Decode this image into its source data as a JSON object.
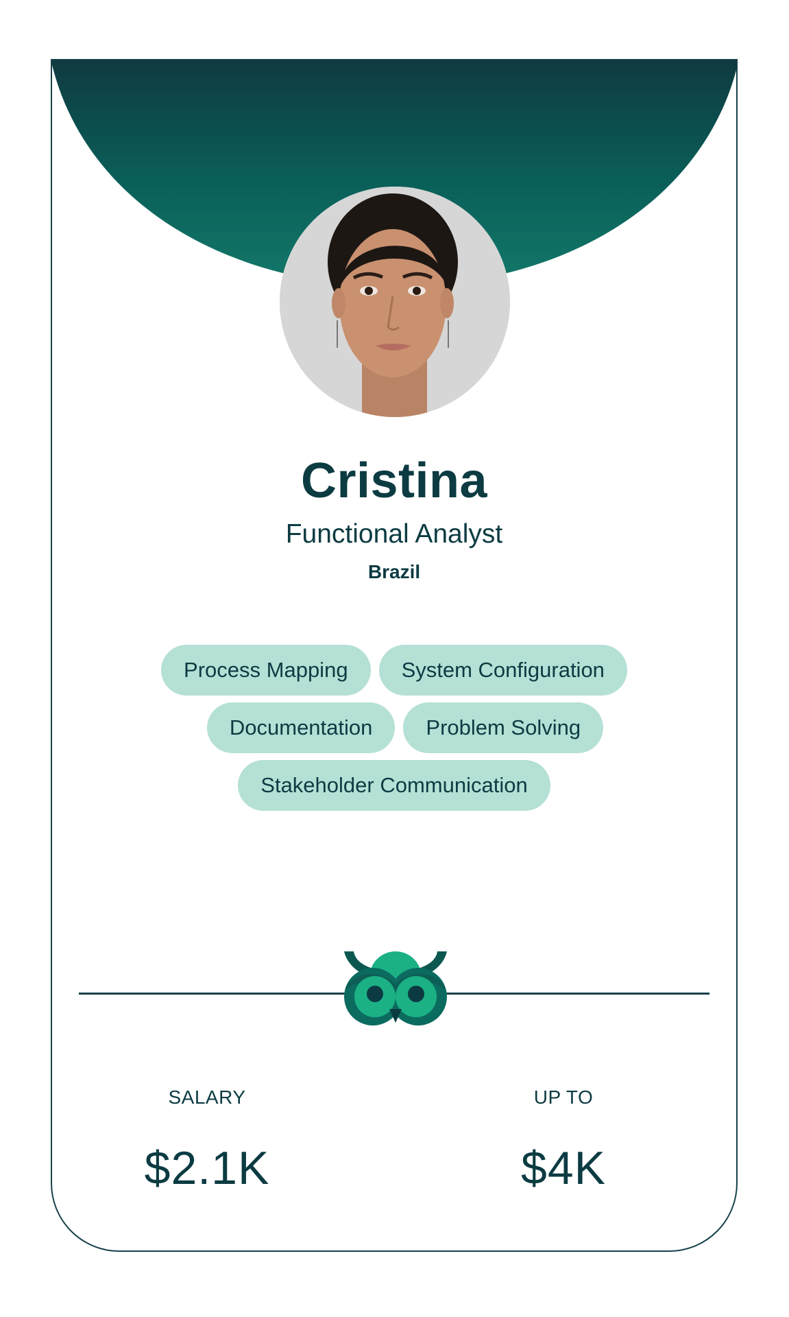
{
  "profile": {
    "name": "Cristina",
    "title": "Functional Analyst",
    "location": "Brazil",
    "photo_alt": "Portrait of Cristina"
  },
  "skills": {
    "row1": [
      "Process Mapping",
      "System Configuration"
    ],
    "row2": [
      "Documentation",
      "Problem Solving"
    ],
    "row3": [
      "Stakeholder Communication"
    ]
  },
  "logo": {
    "icon": "owl-icon"
  },
  "compensation": {
    "salary_label": "SALARY",
    "salary_value": "$2.1K",
    "upto_label": "UP TO",
    "upto_value": "$4K"
  },
  "colors": {
    "header_top": "#0f3a40",
    "header_bottom": "#127569",
    "text": "#0c3b42",
    "tag_bg": "#b5e0d5",
    "owl_green": "#1bb185",
    "owl_dark": "#0b6b5f",
    "border": "#16404a"
  }
}
